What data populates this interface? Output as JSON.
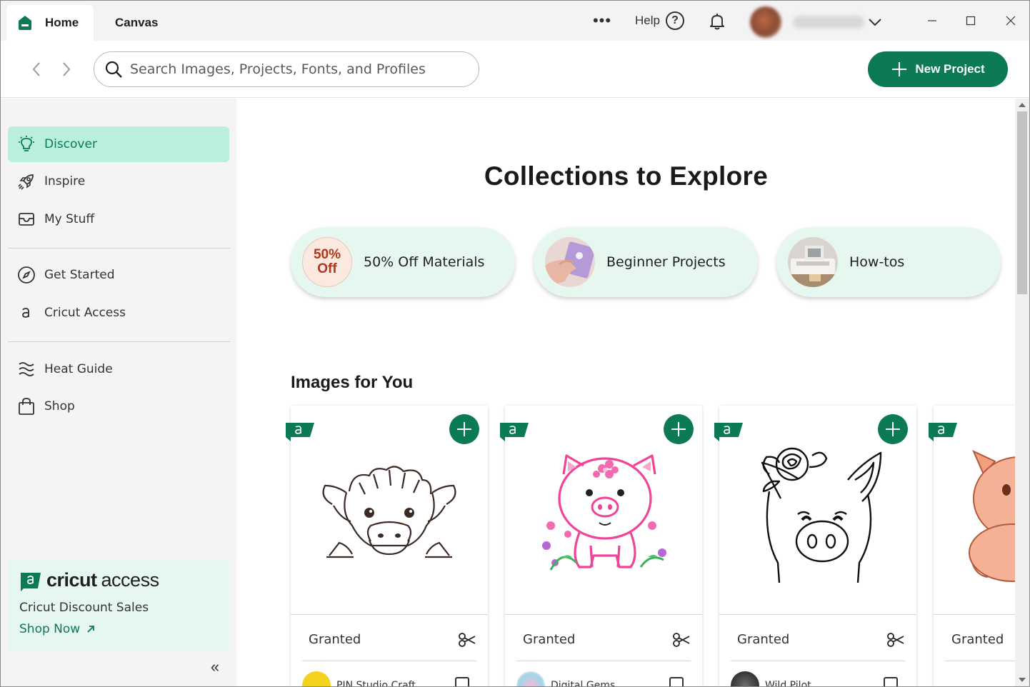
{
  "tabs": {
    "home": "Home",
    "canvas": "Canvas"
  },
  "titlebar": {
    "more": "•••",
    "help_label": "Help",
    "help_icon": "?"
  },
  "search": {
    "placeholder": "Search Images, Projects, Fonts, and Profiles"
  },
  "new_project": "New Project",
  "sidebar": {
    "items": [
      {
        "label": "Discover",
        "icon": "lightbulb-icon",
        "active": true
      },
      {
        "label": "Inspire",
        "icon": "rocket-icon"
      },
      {
        "label": "My Stuff",
        "icon": "inbox-icon"
      },
      {
        "label": "Get Started",
        "icon": "compass-icon"
      },
      {
        "label": "Cricut Access",
        "icon": "access-a-icon"
      },
      {
        "label": "Heat Guide",
        "icon": "heat-waves-icon"
      },
      {
        "label": "Shop",
        "icon": "shopping-bag-icon"
      }
    ],
    "promo": {
      "brand_bold": "cricut",
      "brand_light": "access",
      "text": "Cricut Discount Sales",
      "link": "Shop Now"
    },
    "collapse": "«"
  },
  "main": {
    "collections_title": "Collections to Explore",
    "collections": [
      {
        "label": "50% Off Materials",
        "badge_line1": "50%",
        "badge_line2": "Off"
      },
      {
        "label": "Beginner Projects"
      },
      {
        "label": "How-tos"
      }
    ],
    "images_title": "Images for You",
    "cards": [
      {
        "status": "Granted",
        "author": "PIN Studio Craft",
        "subject": "highland-cow"
      },
      {
        "status": "Granted",
        "author": "Digital Gems",
        "subject": "pink-pig"
      },
      {
        "status": "Granted",
        "author": "Wild Pilot",
        "subject": "pig-with-flower"
      },
      {
        "status": "Granted",
        "author": "",
        "subject": "cartoon-pig"
      }
    ]
  },
  "colors": {
    "accent": "#0b7a55",
    "active_bg": "#b9efdc",
    "pill_bg": "#e6f7f0",
    "pink": "#f0449a"
  }
}
